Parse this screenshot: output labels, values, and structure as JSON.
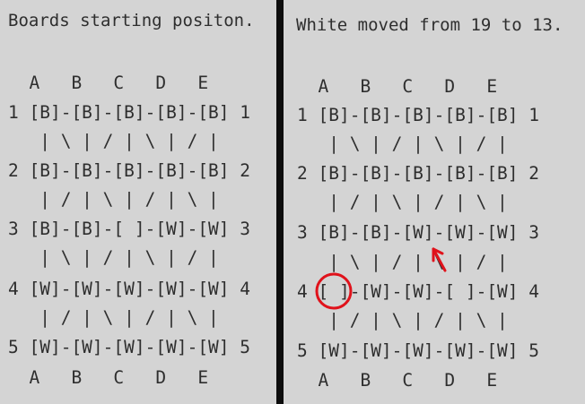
{
  "left_panel": {
    "title": "Boards starting positon.",
    "lines": [
      "  A   B   C   D   E",
      "1 [B]-[B]-[B]-[B]-[B] 1",
      "   | \\ | / | \\ | / |",
      "2 [B]-[B]-[B]-[B]-[B] 2",
      "   | / | \\ | / | \\ |",
      "3 [B]-[B]-[ ]-[W]-[W] 3",
      "   | \\ | / | \\ | / |",
      "4 [W]-[W]-[W]-[W]-[W] 4",
      "   | / | \\ | / | \\ |",
      "5 [W]-[W]-[W]-[W]-[W] 5",
      "  A   B   C   D   E"
    ]
  },
  "right_panel": {
    "title": "White moved from 19 to 13.",
    "lines": [
      "  A   B   C   D   E",
      "1 [B]-[B]-[B]-[B]-[B] 1",
      "   | \\ | / | \\ | / |",
      "2 [B]-[B]-[B]-[B]-[B] 2",
      "   | / | \\ | / | \\ |",
      "3 [B]-[B]-[W]-[W]-[W] 3",
      "   | \\ | / | \\ | / |",
      "4 [ ]-[W]-[W]-[ ]-[W] 4",
      "   | / | \\ | / | \\ |",
      "5 [W]-[W]-[W]-[W]-[W] 5",
      "  A   B   C   D   E"
    ]
  },
  "annotation_color": "#e0121b"
}
